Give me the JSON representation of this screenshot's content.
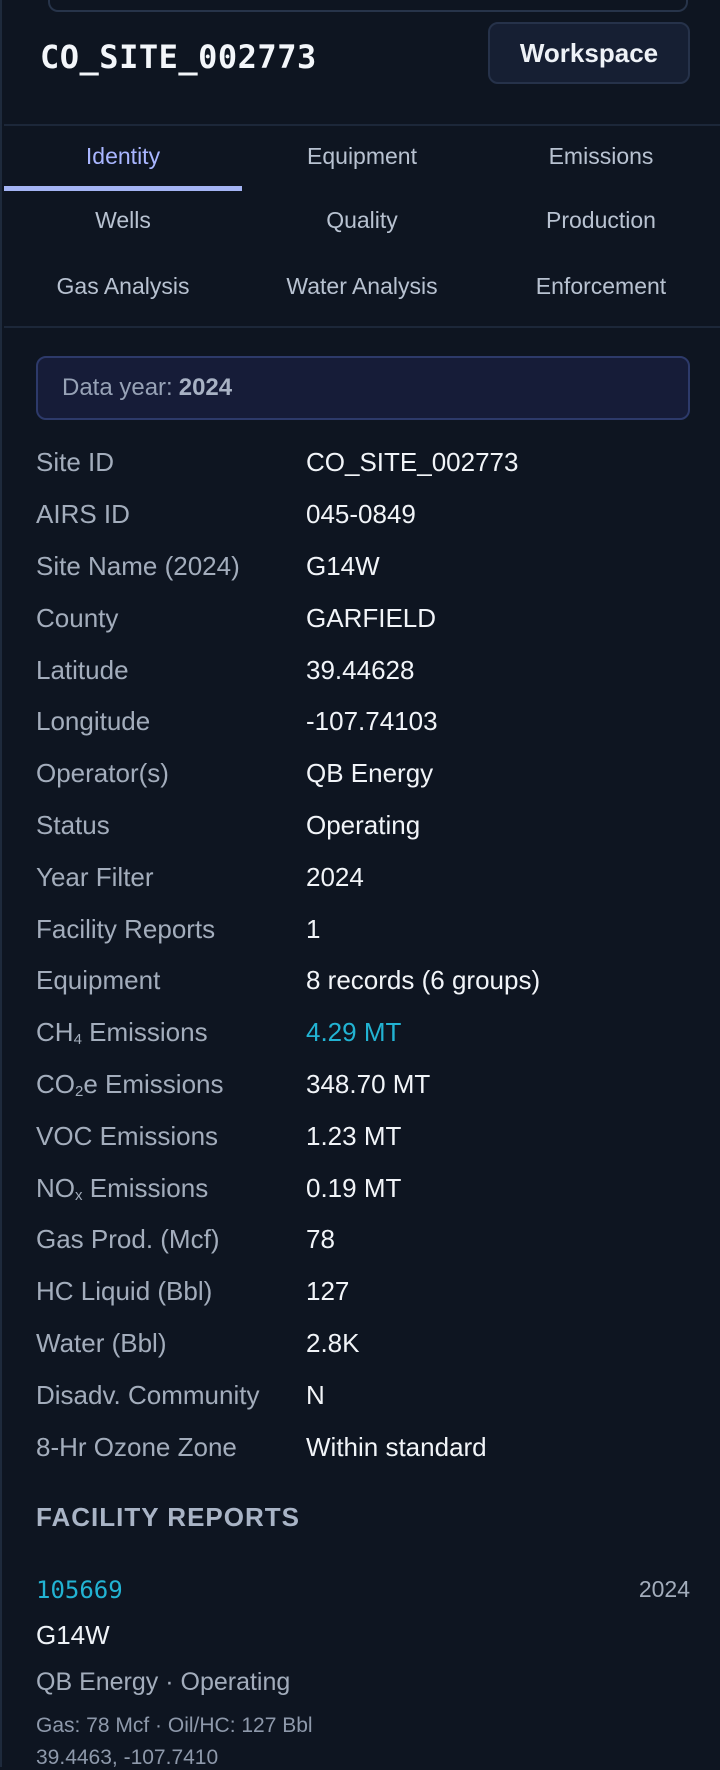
{
  "header": {
    "site_title": "CO_SITE_002773",
    "workspace_label": "Workspace"
  },
  "tabs": [
    {
      "label": "Identity",
      "active": true
    },
    {
      "label": "Equipment"
    },
    {
      "label": "Emissions"
    },
    {
      "label": "Wells"
    },
    {
      "label": "Quality"
    },
    {
      "label": "Production"
    },
    {
      "label": "Gas Analysis"
    },
    {
      "label": "Water Analysis"
    },
    {
      "label": "Enforcement"
    }
  ],
  "data_year": {
    "label": "Data year:",
    "value": "2024"
  },
  "fields": [
    {
      "label": "Site ID",
      "value": "CO_SITE_002773"
    },
    {
      "label": "AIRS ID",
      "value": "045-0849"
    },
    {
      "label": "Site Name (2024)",
      "value": "G14W"
    },
    {
      "label": "County",
      "value": "GARFIELD"
    },
    {
      "label": "Latitude",
      "value": "39.44628"
    },
    {
      "label": "Longitude",
      "value": "-107.74103"
    },
    {
      "label": "Operator(s)",
      "value": "QB Energy"
    },
    {
      "label": "Status",
      "value": "Operating"
    },
    {
      "label": "Year Filter",
      "value": "2024"
    },
    {
      "label": "Facility Reports",
      "value": "1"
    },
    {
      "label": "Equipment",
      "value": "8 records (6 groups)"
    },
    {
      "label_main": "CH",
      "label_sub": "4",
      "label_rest": " Emissions",
      "value": "4.29 MT",
      "accent": "#22b3d3"
    },
    {
      "label_main": "CO",
      "label_sub": "2",
      "label_rest": "e Emissions",
      "value": "348.70 MT"
    },
    {
      "label": "VOC Emissions",
      "value": "1.23 MT"
    },
    {
      "label_main": "NO",
      "label_sub": "x",
      "label_rest": " Emissions",
      "value": "0.19 MT"
    },
    {
      "label": "Gas Prod. (Mcf)",
      "value": "78"
    },
    {
      "label": "HC Liquid (Bbl)",
      "value": "127"
    },
    {
      "label": "Water (Bbl)",
      "value": "2.8K"
    },
    {
      "label": "Disadv. Community",
      "value": "N"
    },
    {
      "label": "8-Hr Ozone Zone",
      "value": "Within standard"
    }
  ],
  "facility_reports": {
    "heading": "FACILITY REPORTS",
    "items": [
      {
        "id": "105669",
        "year": "2024",
        "name": "G14W",
        "meta": "QB Energy · Operating",
        "production": "Gas: 78 Mcf · Oil/HC: 127 Bbl",
        "coords": "39.4463, -107.7410"
      }
    ]
  }
}
